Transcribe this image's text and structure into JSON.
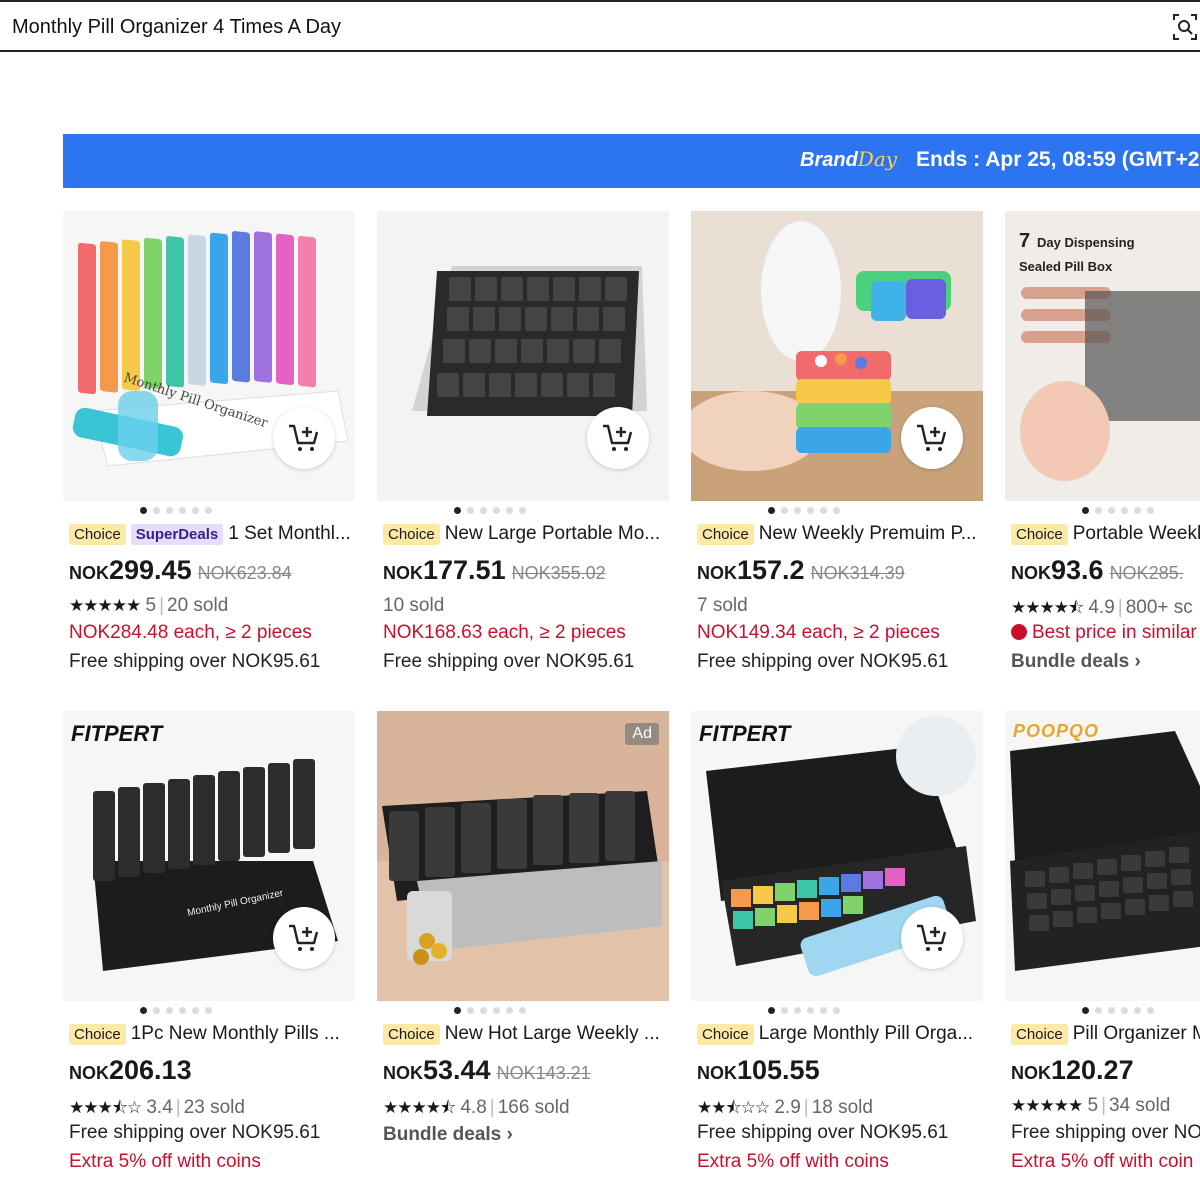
{
  "search": {
    "query": "Monthly Pill Organizer 4 Times A Day",
    "camera_icon": "camera-search-icon"
  },
  "banner": {
    "brand_a": "Brand",
    "brand_b": "Day",
    "ends": "Ends :  Apr 25, 08:59 (GMT+2"
  },
  "colors": {
    "banner": "#2d74f0",
    "choice_tag": "#fde9a6",
    "red": "#c8102e"
  },
  "products": [
    {
      "choice": "Choice",
      "super": "SuperDeals",
      "title": "1 Set Monthl...",
      "currency": "NOK",
      "price": "299.45",
      "old_price": "NOK623.84",
      "stars": "★★★★★",
      "rating": "5",
      "sold": "20 sold",
      "line_a": "NOK284.48 each, ≥ 2 pieces",
      "line_b": "Free shipping over NOK95.61"
    },
    {
      "choice": "Choice",
      "title": "New Large Portable Mo...",
      "currency": "NOK",
      "price": "177.51",
      "old_price": "NOK355.02",
      "sold": "10 sold",
      "line_a": "NOK168.63 each, ≥ 2 pieces",
      "line_b": "Free shipping over NOK95.61"
    },
    {
      "choice": "Choice",
      "title": "New Weekly Premuim P...",
      "currency": "NOK",
      "price": "157.2",
      "old_price": "NOK314.39",
      "sold": "7 sold",
      "line_a": "NOK149.34 each, ≥ 2 pieces",
      "line_b": "Free shipping over NOK95.61"
    },
    {
      "choice": "Choice",
      "title": "Portable Weekl",
      "currency": "NOK",
      "price": "93.6",
      "old_price": "NOK285.",
      "stars": "★★★★⯪",
      "rating": "4.9",
      "sold": "800+ sc",
      "line_a": "Best price in similar",
      "line_b": "Bundle deals ›"
    },
    {
      "choice": "Choice",
      "title": "1Pc New Monthly Pills ...",
      "brand": "FITPERT",
      "currency": "NOK",
      "price": "206.13",
      "stars": "★★★⯪☆",
      "rating": "3.4",
      "sold": "23 sold",
      "line_a": "Free shipping over NOK95.61",
      "line_b": "Extra 5% off with coins"
    },
    {
      "choice": "Choice",
      "title": "New Hot Large Weekly ...",
      "ad": "Ad",
      "currency": "NOK",
      "price": "53.44",
      "old_price": "NOK143.21",
      "stars": "★★★★⯪",
      "rating": "4.8",
      "sold": "166 sold",
      "line_a": "Bundle deals ›"
    },
    {
      "choice": "Choice",
      "title": "Large Monthly Pill Orga...",
      "brand": "FITPERT",
      "currency": "NOK",
      "price": "105.55",
      "stars": "★★⯪☆☆",
      "rating": "2.9",
      "sold": "18 sold",
      "line_a": "Free shipping over NOK95.61",
      "line_b": "Extra 5% off with coins"
    },
    {
      "choice": "Choice",
      "title": "Pill Organizer M",
      "brand": "POOPQO",
      "currency": "NOK",
      "price": "120.27",
      "stars": "★★★★★",
      "rating": "5",
      "sold": "34 sold",
      "line_a": "Free shipping over NO",
      "line_b": "Extra 5% off with coin"
    }
  ]
}
